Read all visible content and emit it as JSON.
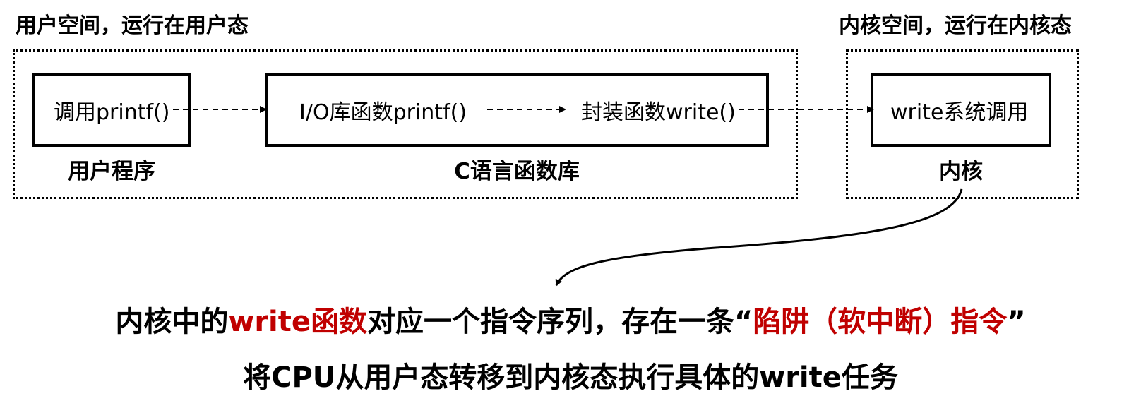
{
  "user_space": {
    "title": "用户空间，运行在用户态",
    "user_program": {
      "box_text": "调用printf()",
      "caption": "用户程序"
    },
    "c_library": {
      "func_left": "I/O库函数printf()",
      "func_right": "封装函数write()",
      "caption": "C语言函数库"
    }
  },
  "kernel_space": {
    "title": "内核空间，运行在内核态",
    "box_text": "write系统调用",
    "caption": "内核"
  },
  "explanation": {
    "line1_a": "内核中的",
    "line1_b": "write函数",
    "line1_c": "对应一个指令序列，存在一条“",
    "line1_d": "陷阱（软中断）指令",
    "line1_e": "”",
    "line2": "将CPU从用户态转移到内核态执行具体的write任务"
  },
  "colors": {
    "highlight": "#c00000"
  }
}
